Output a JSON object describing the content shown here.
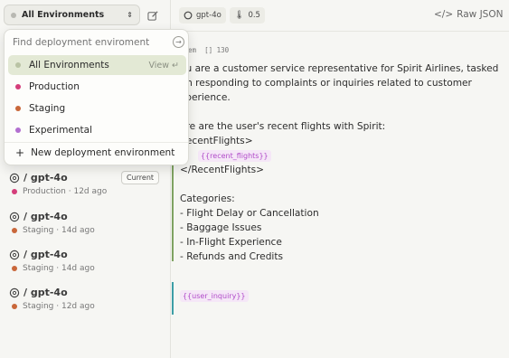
{
  "sidebar": {
    "env_selector_label": "All Environments",
    "versions": [
      {
        "title": "/ gpt-4o",
        "env": "Production",
        "age": "12d ago",
        "badge": "Current",
        "color": "#d43d7a"
      },
      {
        "title": "/ gpt-4o",
        "env": "Staging",
        "age": "14d ago",
        "badge": "",
        "color": "#c9673a"
      },
      {
        "title": "/ gpt-4o",
        "env": "Staging",
        "age": "14d ago",
        "badge": "",
        "color": "#c9673a"
      },
      {
        "title": "/ gpt-4o",
        "env": "Staging",
        "age": "12d ago",
        "badge": "",
        "color": "#c9673a"
      }
    ]
  },
  "dropdown": {
    "search_placeholder": "Find deployment enviroment",
    "items": [
      {
        "label": "All Environments",
        "color": "#b9c3a4",
        "hint": "View ↵"
      },
      {
        "label": "Production",
        "color": "#d43d7a"
      },
      {
        "label": "Staging",
        "color": "#c9673a"
      },
      {
        "label": "Experimental",
        "color": "#b26fd0"
      }
    ],
    "new_env_label": "New deployment environment"
  },
  "toolbar": {
    "model": "gpt-4o",
    "temperature": "0.5",
    "raw_json_label": "Raw JSON"
  },
  "message": {
    "role": "stem",
    "token_count": "[] 130",
    "lines": [
      "ou are a customer service representative for Spirit Airlines, tasked",
      "ith responding to complaints or inquiries related to customer",
      "xperience.",
      "",
      "ere are the user's recent flights with Spirit:",
      "RecentFlights>",
      "",
      "</RecentFlights>",
      "",
      "Categories:",
      "- Flight Delay or Cancellation",
      "- Baggage Issues",
      "- In-Flight Experience",
      "- Refunds and Credits"
    ],
    "var_recent_flights": "{{recent_flights}}",
    "var_user_inquiry": "{{user_inquiry}}"
  }
}
